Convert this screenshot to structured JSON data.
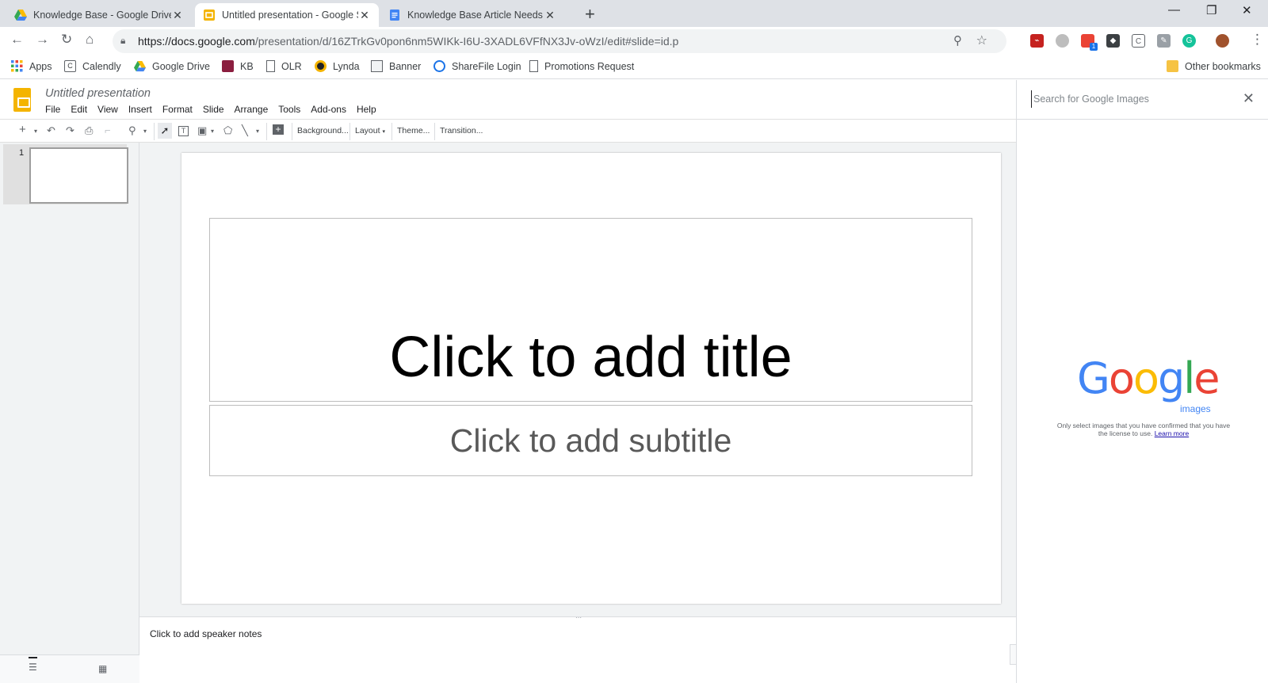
{
  "browser": {
    "tabs": [
      {
        "title": "Knowledge Base - Google Drive",
        "icon": "google-drive-icon",
        "active": false
      },
      {
        "title": "Untitled presentation - Google S",
        "icon": "google-slides-icon",
        "active": true
      },
      {
        "title": "Knowledge Base Article Needs - ",
        "icon": "google-docs-icon",
        "active": false
      }
    ],
    "url_host": "https://docs.google.com",
    "url_path": "/presentation/d/16ZTrkGv0pon6nm5WIKk-I6U-3XADL6VFfNX3Jv-oWzI/edit#slide=id.p",
    "bookmarks": [
      "Apps",
      "Calendly",
      "Google Drive",
      "KB",
      "OLR",
      "Lynda",
      "Banner",
      "ShareFile Login",
      "Promotions Request"
    ],
    "other_bookmarks": "Other bookmarks",
    "extension_badge": "1"
  },
  "slides": {
    "doc_title": "Untitled presentation",
    "menu": [
      "File",
      "Edit",
      "View",
      "Insert",
      "Format",
      "Slide",
      "Arrange",
      "Tools",
      "Add-ons",
      "Help"
    ],
    "toolbar": {
      "background": "Background...",
      "layout": "Layout",
      "theme": "Theme...",
      "transition": "Transition..."
    },
    "slide_number": "1",
    "title_placeholder": "Click to add title",
    "subtitle_placeholder": "Click to add subtitle",
    "speaker_notes": "Click to add speaker notes"
  },
  "side_panel": {
    "search_placeholder": "Search for Google Images",
    "logo_letters": [
      "G",
      "o",
      "o",
      "g",
      "l",
      "e"
    ],
    "logo_sub": "images",
    "disclaimer": "Only select images that you have confirmed that you have the license to use.",
    "learn_more": "Learn more"
  },
  "colors": {
    "slides_yellow": "#f4b400",
    "google_blue": "#4285f4",
    "google_red": "#ea4335",
    "google_yellow": "#fbbc05",
    "google_green": "#34a853"
  }
}
